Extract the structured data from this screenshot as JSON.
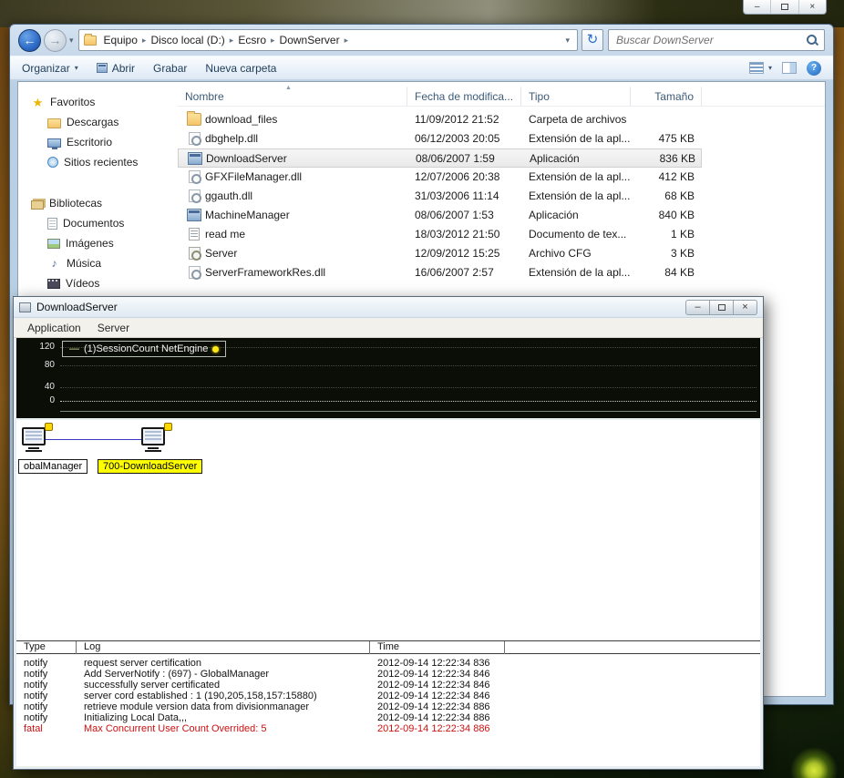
{
  "icons": {
    "back_arrow": "←",
    "forward_arrow": "→",
    "chevron_down": "▾",
    "breadcrumb_separator": "▸",
    "refresh": "↻",
    "help": "?",
    "minimize": "–",
    "close": "×",
    "star": "★",
    "music_note": "♪",
    "sort_ascending": "▲",
    "legend_dash": "—"
  },
  "desktop": {
    "background_window_controls": [
      "minimize",
      "maximize",
      "close"
    ]
  },
  "explorer": {
    "breadcrumb": {
      "items": [
        "Equipo",
        "Disco local (D:)",
        "Ecsro",
        "DownServer"
      ]
    },
    "search": {
      "placeholder": "Buscar DownServer",
      "value": ""
    },
    "toolbar": {
      "organize": "Organizar",
      "open": "Abrir",
      "burn": "Grabar",
      "new_folder": "Nueva carpeta"
    },
    "sidebar": {
      "sections": [
        {
          "label": "Favoritos",
          "items": [
            "Descargas",
            "Escritorio",
            "Sitios recientes"
          ]
        },
        {
          "label": "Bibliotecas",
          "items": [
            "Documentos",
            "Imágenes",
            "Música",
            "Vídeos"
          ]
        }
      ]
    },
    "columns": [
      "Nombre",
      "Fecha de modifica...",
      "Tipo",
      "Tamaño"
    ],
    "files": [
      {
        "name": "download_files",
        "date": "11/09/2012 21:52",
        "type": "Carpeta de archivos",
        "size": "",
        "icon": "folder",
        "selected": false
      },
      {
        "name": "dbghelp.dll",
        "date": "06/12/2003 20:05",
        "type": "Extensión de la apl...",
        "size": "475 KB",
        "icon": "dll",
        "selected": false
      },
      {
        "name": "DownloadServer",
        "date": "08/06/2007 1:59",
        "type": "Aplicación",
        "size": "836 KB",
        "icon": "application",
        "selected": true
      },
      {
        "name": "GFXFileManager.dll",
        "date": "12/07/2006 20:38",
        "type": "Extensión de la apl...",
        "size": "412 KB",
        "icon": "dll",
        "selected": false
      },
      {
        "name": "ggauth.dll",
        "date": "31/03/2006 11:14",
        "type": "Extensión de la apl...",
        "size": "68 KB",
        "icon": "dll",
        "selected": false
      },
      {
        "name": "MachineManager",
        "date": "08/06/2007 1:53",
        "type": "Aplicación",
        "size": "840 KB",
        "icon": "application",
        "selected": false
      },
      {
        "name": "read me",
        "date": "18/03/2012 21:50",
        "type": "Documento de tex...",
        "size": "1 KB",
        "icon": "text",
        "selected": false
      },
      {
        "name": "Server",
        "date": "12/09/2012 15:25",
        "type": "Archivo CFG",
        "size": "3 KB",
        "icon": "config",
        "selected": false
      },
      {
        "name": "ServerFrameworkRes.dll",
        "date": "16/06/2007 2:57",
        "type": "Extensión de la apl...",
        "size": "84 KB",
        "icon": "dll",
        "selected": false
      }
    ]
  },
  "app": {
    "title": "DownloadServer",
    "menu": [
      "Application",
      "Server"
    ],
    "chart": {
      "yticks": [
        "120",
        "80",
        "40",
        "0"
      ],
      "legend": "(1)SessionCount NetEngine",
      "series_color": "#f0e850",
      "status_dot_color": "#ffe818"
    },
    "nodes": [
      {
        "label": "obalManager",
        "highlighted": false
      },
      {
        "label": "700-DownloadServer",
        "highlighted": true
      }
    ],
    "log": {
      "columns": [
        "Type",
        "Log",
        "Time"
      ],
      "rows": [
        {
          "type": "notify",
          "message": "request server certification",
          "time": "2012-09-14 12:22:34 836"
        },
        {
          "type": "notify",
          "message": "Add ServerNotify : (697) - GlobalManager",
          "time": "2012-09-14 12:22:34 846"
        },
        {
          "type": "notify",
          "message": "successfully server certificated",
          "time": "2012-09-14 12:22:34 846"
        },
        {
          "type": "notify",
          "message": "server cord established : 1 (190,205,158,157:15880)",
          "time": "2012-09-14 12:22:34 846"
        },
        {
          "type": "notify",
          "message": "retrieve module version data from divisionmanager",
          "time": "2012-09-14 12:22:34 886"
        },
        {
          "type": "notify",
          "message": "Initializing Local Data,,,",
          "time": "2012-09-14 12:22:34 886"
        },
        {
          "type": "fatal",
          "message": "Max Concurrent User Count Overrided: 5",
          "time": "2012-09-14 12:22:34 886"
        }
      ]
    }
  },
  "chart_data": {
    "type": "line",
    "title": "",
    "series": [
      {
        "name": "(1)SessionCount NetEngine",
        "values": [
          0
        ],
        "color": "#f0e850"
      }
    ],
    "ylim": [
      0,
      120
    ],
    "yticks": [
      0,
      40,
      80,
      120
    ],
    "legend_position": "top-left",
    "grid": true
  }
}
